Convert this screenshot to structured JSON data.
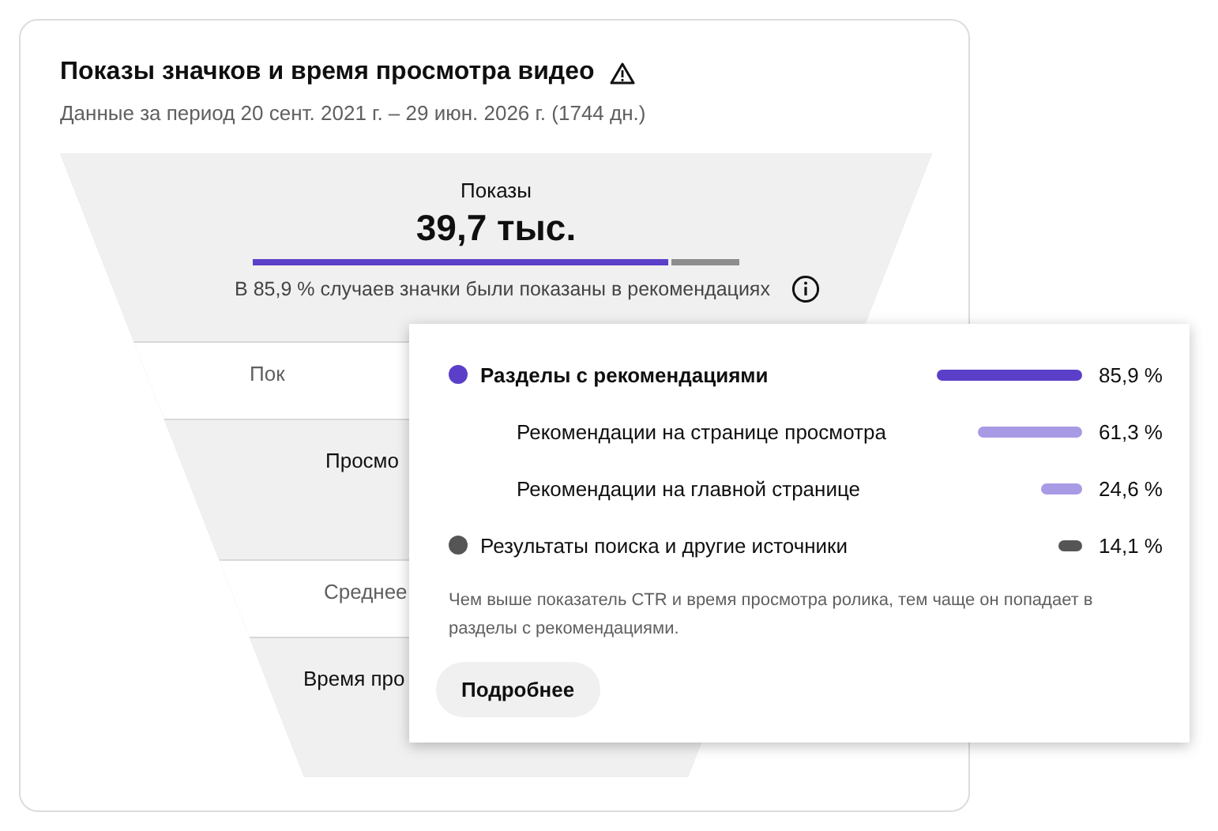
{
  "card": {
    "title": "Показы значков и время просмотра видео",
    "subtitle": "Данные за период 20 сент. 2021 г. – 29 июн. 2026 г. (1744 дн.)"
  },
  "funnel": {
    "top": {
      "label": "Показы",
      "value": "39,7 тыс.",
      "level": 0.859,
      "caption": "В 85,9 % случаев значки были показаны в рекомендациях"
    },
    "stages": [
      {
        "label": "Пок",
        "kind": "thin"
      },
      {
        "label": "Просмо",
        "kind": "tall"
      },
      {
        "label": "Среднее",
        "kind": "thin"
      },
      {
        "label": "Время про",
        "kind": "tall"
      }
    ]
  },
  "popup": {
    "rows": [
      {
        "label": "Разделы с рекомендациями",
        "kind": "category",
        "color": "#5b3fc9",
        "reading": "85,9 %"
      },
      {
        "label": "Рекомендации на странице просмотра",
        "kind": "subcategory",
        "color": "#a99ae6",
        "reading": "61,3 %"
      },
      {
        "label": "Рекомендации на главной странице",
        "kind": "subcategory",
        "color": "#a99ae6",
        "reading": "24,6 %"
      },
      {
        "label": "Результаты поиска и другие источники",
        "kind": "category",
        "color": "#555555",
        "reading": "14,1 %"
      }
    ],
    "note": "Чем выше показатель CTR и время просмотра ролика, тем чаще он попадает в разделы с рекомендациями.",
    "button": "Подробнее"
  }
}
